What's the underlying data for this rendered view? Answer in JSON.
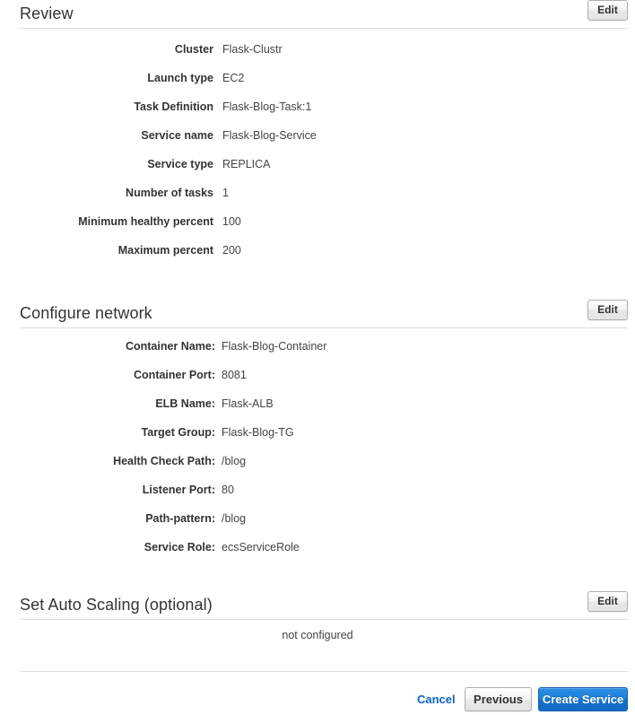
{
  "sections": [
    {
      "id": "review",
      "title": "Review",
      "edit_label": "Edit",
      "rows": [
        {
          "label": "Cluster",
          "value": "Flask-Clustr"
        },
        {
          "label": "Launch type",
          "value": "EC2"
        },
        {
          "label": "Task Definition",
          "value": "Flask-Blog-Task:1"
        },
        {
          "label": "Service name",
          "value": "Flask-Blog-Service"
        },
        {
          "label": "Service type",
          "value": "REPLICA"
        },
        {
          "label": "Number of tasks",
          "value": "1"
        },
        {
          "label": "Minimum healthy percent",
          "value": "100"
        },
        {
          "label": "Maximum percent",
          "value": "200"
        }
      ]
    },
    {
      "id": "configure-network",
      "title": "Configure network",
      "edit_label": "Edit",
      "rows": [
        {
          "label": "Container Name:",
          "value": "Flask-Blog-Container"
        },
        {
          "label": "Container Port:",
          "value": "8081"
        },
        {
          "label": "ELB Name:",
          "value": "Flask-ALB"
        },
        {
          "label": "Target Group:",
          "value": "Flask-Blog-TG"
        },
        {
          "label": "Health Check Path:",
          "value": "/blog"
        },
        {
          "label": "Listener Port:",
          "value": "80"
        },
        {
          "label": "Path-pattern:",
          "value": "/blog"
        },
        {
          "label": "Service Role:",
          "value": "ecsServiceRole"
        }
      ]
    },
    {
      "id": "auto-scaling",
      "title": "Set Auto Scaling (optional)",
      "edit_label": "Edit",
      "empty_text": "not configured"
    }
  ],
  "footer": {
    "cancel_label": "Cancel",
    "previous_label": "Previous",
    "create_label": "Create Service"
  },
  "colors": {
    "accent_blue": "#1572cd",
    "link_blue": "#0b64c4",
    "text": "#333333",
    "rule": "#dddddd"
  }
}
